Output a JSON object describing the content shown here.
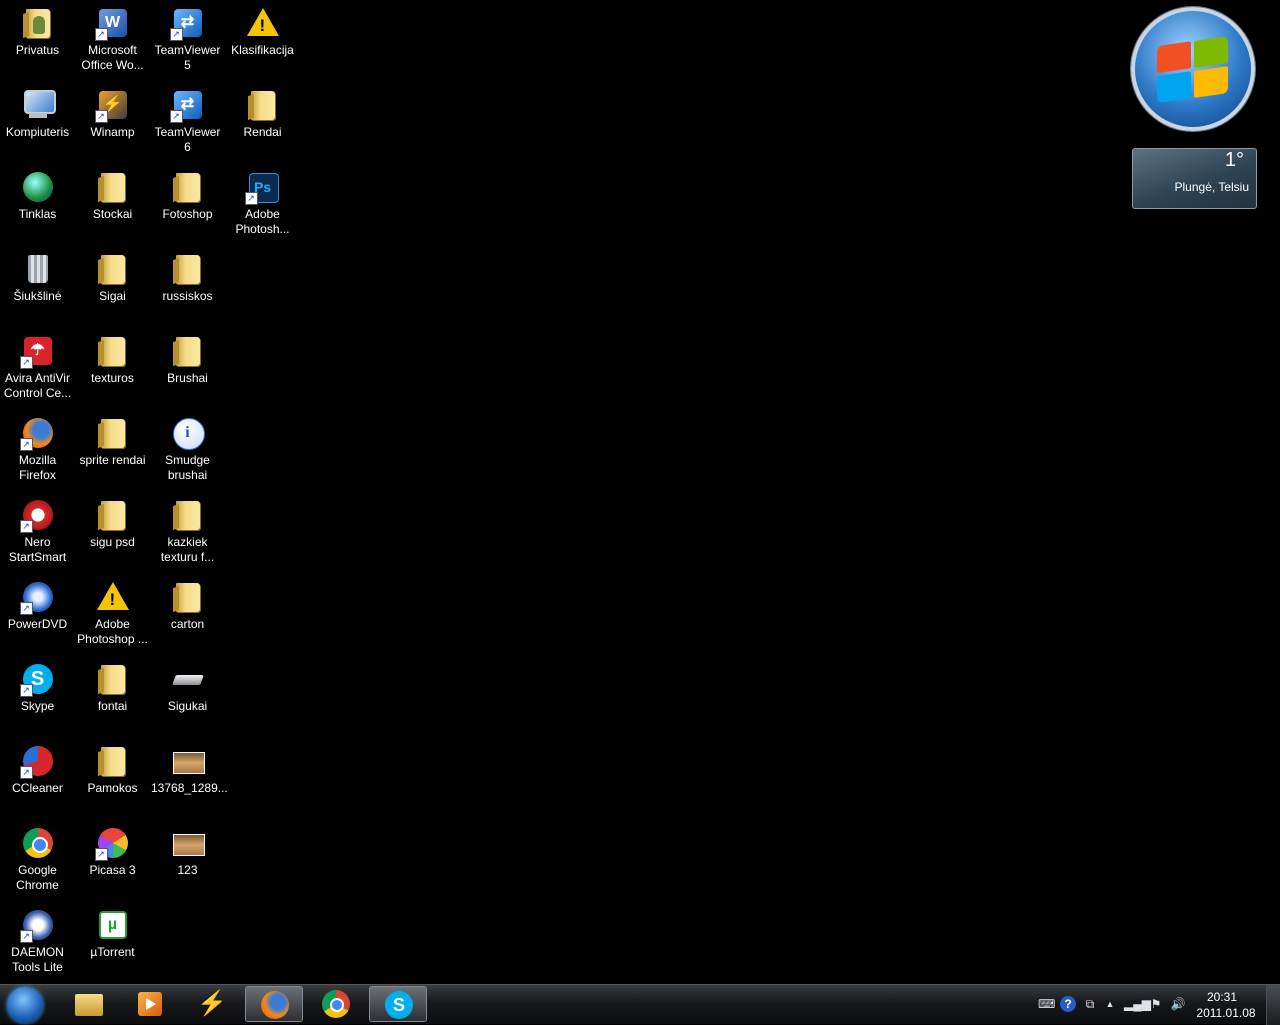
{
  "desktop": {
    "columns": [
      [
        {
          "label": "Privatus",
          "icon": "user-folder-icon",
          "kind": "userfolder"
        },
        {
          "label": "Kompiuteris",
          "icon": "computer-icon",
          "kind": "computer"
        },
        {
          "label": "Tinklas",
          "icon": "network-icon",
          "kind": "network"
        },
        {
          "label": "Šiukšlinė",
          "icon": "recycle-bin-icon",
          "kind": "bin"
        },
        {
          "label": "Avira AntiVir\nControl Ce...",
          "icon": "avira-icon",
          "kind": "avira"
        },
        {
          "label": "Mozilla\nFirefox",
          "icon": "firefox-icon",
          "kind": "firefox"
        },
        {
          "label": "Nero\nStartSmart",
          "icon": "nero-icon",
          "kind": "nero"
        },
        {
          "label": "PowerDVD",
          "icon": "powerdvd-icon",
          "kind": "powerdvd"
        },
        {
          "label": "Skype",
          "icon": "skype-icon",
          "kind": "skype"
        },
        {
          "label": "CCleaner",
          "icon": "ccleaner-icon",
          "kind": "ccleaner"
        },
        {
          "label": "Google\nChrome",
          "icon": "chrome-icon",
          "kind": "chrome"
        },
        {
          "label": "DAEMON\nTools Lite",
          "icon": "daemon-tools-icon",
          "kind": "daemon"
        }
      ],
      [
        {
          "label": "Microsoft\nOffice Wo...",
          "icon": "word-icon",
          "kind": "word"
        },
        {
          "label": "Winamp",
          "icon": "winamp-icon",
          "kind": "winamp"
        },
        {
          "label": "Stockai",
          "icon": "folder-icon",
          "kind": "folder"
        },
        {
          "label": "Sigai",
          "icon": "folder-icon",
          "kind": "folder"
        },
        {
          "label": "texturos",
          "icon": "folder-icon",
          "kind": "folder"
        },
        {
          "label": "sprite rendai",
          "icon": "folder-icon",
          "kind": "folder"
        },
        {
          "label": "sigu psd",
          "icon": "folder-icon",
          "kind": "folder"
        },
        {
          "label": "Adobe\nPhotoshop ...",
          "icon": "warning-icon",
          "kind": "warning"
        },
        {
          "label": "fontai",
          "icon": "folder-icon",
          "kind": "folder"
        },
        {
          "label": "Pamokos",
          "icon": "folder-icon",
          "kind": "folder"
        },
        {
          "label": "Picasa 3",
          "icon": "picasa-icon",
          "kind": "picasa"
        },
        {
          "label": "µTorrent",
          "icon": "utorrent-icon",
          "kind": "utorrent"
        }
      ],
      [
        {
          "label": "TeamViewer\n5",
          "icon": "teamviewer-icon",
          "kind": "teamviewer"
        },
        {
          "label": "TeamViewer\n6",
          "icon": "teamviewer-icon",
          "kind": "teamviewer"
        },
        {
          "label": "Fotoshop",
          "icon": "folder-icon",
          "kind": "folder"
        },
        {
          "label": "russiskos",
          "icon": "folder-icon",
          "kind": "folder"
        },
        {
          "label": "Brushai",
          "icon": "folder-icon",
          "kind": "folder"
        },
        {
          "label": "Smudge\nbrushai",
          "icon": "info-icon",
          "kind": "info"
        },
        {
          "label": "kazkiek\ntexturu f...",
          "icon": "folder-icon",
          "kind": "folder"
        },
        {
          "label": "carton",
          "icon": "folder-icon",
          "kind": "folder"
        },
        {
          "label": "Sigukai",
          "icon": "drive-icon",
          "kind": "drive"
        },
        {
          "label": "13768_1289...",
          "icon": "image-thumbnail-icon",
          "kind": "thumb"
        },
        {
          "label": "123",
          "icon": "image-thumbnail-icon",
          "kind": "thumb"
        }
      ],
      [
        {
          "label": "Klasifikacija",
          "icon": "warning-icon",
          "kind": "warning"
        },
        {
          "label": "Rendai",
          "icon": "folder-icon",
          "kind": "folder"
        },
        {
          "label": "Adobe\nPhotosh...",
          "icon": "photoshop-icon",
          "kind": "photoshop"
        }
      ]
    ]
  },
  "gadgets": {
    "weather": {
      "temperature": "1°",
      "location": "Plungė, Telsiu"
    }
  },
  "taskbar": {
    "start_icon": "windows-start-orb-icon",
    "pinned": [
      {
        "name": "explorer",
        "icon": "explorer-icon",
        "active": false
      },
      {
        "name": "media-player",
        "icon": "media-player-icon",
        "active": false
      },
      {
        "name": "winamp",
        "icon": "winamp-icon",
        "active": false
      },
      {
        "name": "firefox",
        "icon": "firefox-icon",
        "active": true
      },
      {
        "name": "chrome",
        "icon": "chrome-icon",
        "active": false
      },
      {
        "name": "skype",
        "icon": "skype-icon",
        "active": true
      }
    ],
    "tray": {
      "time": "20:31",
      "date": "2011.01.08"
    }
  }
}
